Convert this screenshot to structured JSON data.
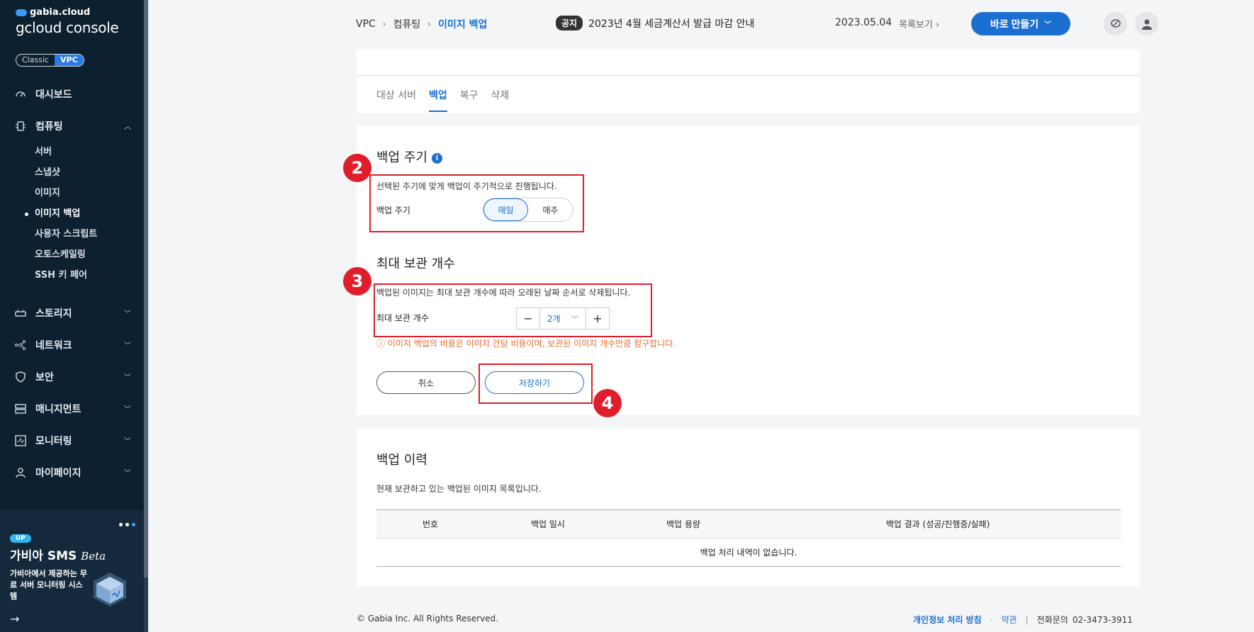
{
  "sidebar": {
    "brand_top": "gabia.cloud",
    "brand_main": "gcloud console",
    "toggle": {
      "classic": "Classic",
      "vpc": "VPC"
    },
    "items": [
      {
        "label": "대시보드",
        "icon": "dashboard-icon"
      },
      {
        "label": "컴퓨팅",
        "icon": "chip-icon",
        "expanded": true
      },
      {
        "label": "스토리지",
        "icon": "storage-icon"
      },
      {
        "label": "네트워크",
        "icon": "network-icon"
      },
      {
        "label": "보안",
        "icon": "shield-icon"
      },
      {
        "label": "매니지먼트",
        "icon": "management-icon"
      },
      {
        "label": "모니터링",
        "icon": "monitor-icon"
      },
      {
        "label": "마이페이지",
        "icon": "user-icon"
      }
    ],
    "sub_items": [
      "서버",
      "스냅샷",
      "이미지",
      "이미지 백업",
      "사용자 스크립트",
      "오토스케일링",
      "SSH 키 페어"
    ],
    "active_sub": "이미지 백업",
    "promo": {
      "badge": "UP",
      "title": "가비아 SMS",
      "title_em": "Beta",
      "desc": "가비아에서 제공하는 무료 서버 모니터링 시스템"
    }
  },
  "header": {
    "breadcrumb": [
      "VPC",
      "컴퓨팅",
      "이미지 백업"
    ],
    "notice_tag": "공지",
    "notice_text": "2023년 4월 세금계산서 발급 마감 안내",
    "notice_date": "2023.05.04",
    "notice_more": "목록보기",
    "make_button": "바로 만들기"
  },
  "tabs": [
    "대상 서버",
    "백업",
    "복구",
    "삭제"
  ],
  "active_tab": "백업",
  "backup_cycle": {
    "title": "백업 주기",
    "desc": "선택된 주기에 맞게 백업이 주기적으로 진행됩니다.",
    "label": "백업 주기",
    "options": [
      "매일",
      "매주"
    ],
    "selected": "매일"
  },
  "max_keep": {
    "title": "최대 보관 개수",
    "desc": "백업된 이미지는 최대 보관 개수에 따라 오래된 날짜 순서로 삭제됩니다.",
    "label": "최대 보관 개수",
    "value": "2개",
    "minus": "−",
    "plus": "+",
    "warning": "ⓘ 이미지 백업의 비용은 이미지 건당 비용이며, 보관된 이미지 개수만큼 청구합니다."
  },
  "actions": {
    "cancel": "취소",
    "save": "저장하기"
  },
  "annotations": [
    "2",
    "3",
    "4"
  ],
  "history": {
    "title": "백업 이력",
    "desc": "현재 보관하고 있는 백업된 이미지 목록입니다.",
    "columns": [
      "번호",
      "백업 일시",
      "백업 용량",
      "백업 결과 (성공/진행중/실패)"
    ],
    "empty": "백업 처리 내역이 없습니다."
  },
  "footer": {
    "copyright": "© Gabia Inc. All Rights Reserved.",
    "privacy": "개인정보 처리 방침",
    "dot": "·",
    "terms": "약관",
    "sep": "|",
    "phone_label": "전화문의",
    "phone": "02-3473-3911"
  },
  "colors": {
    "accent": "#1b6fd1",
    "sidebar": "#0d2030",
    "annotation": "#e01e2b",
    "warning": "#e8692b"
  }
}
